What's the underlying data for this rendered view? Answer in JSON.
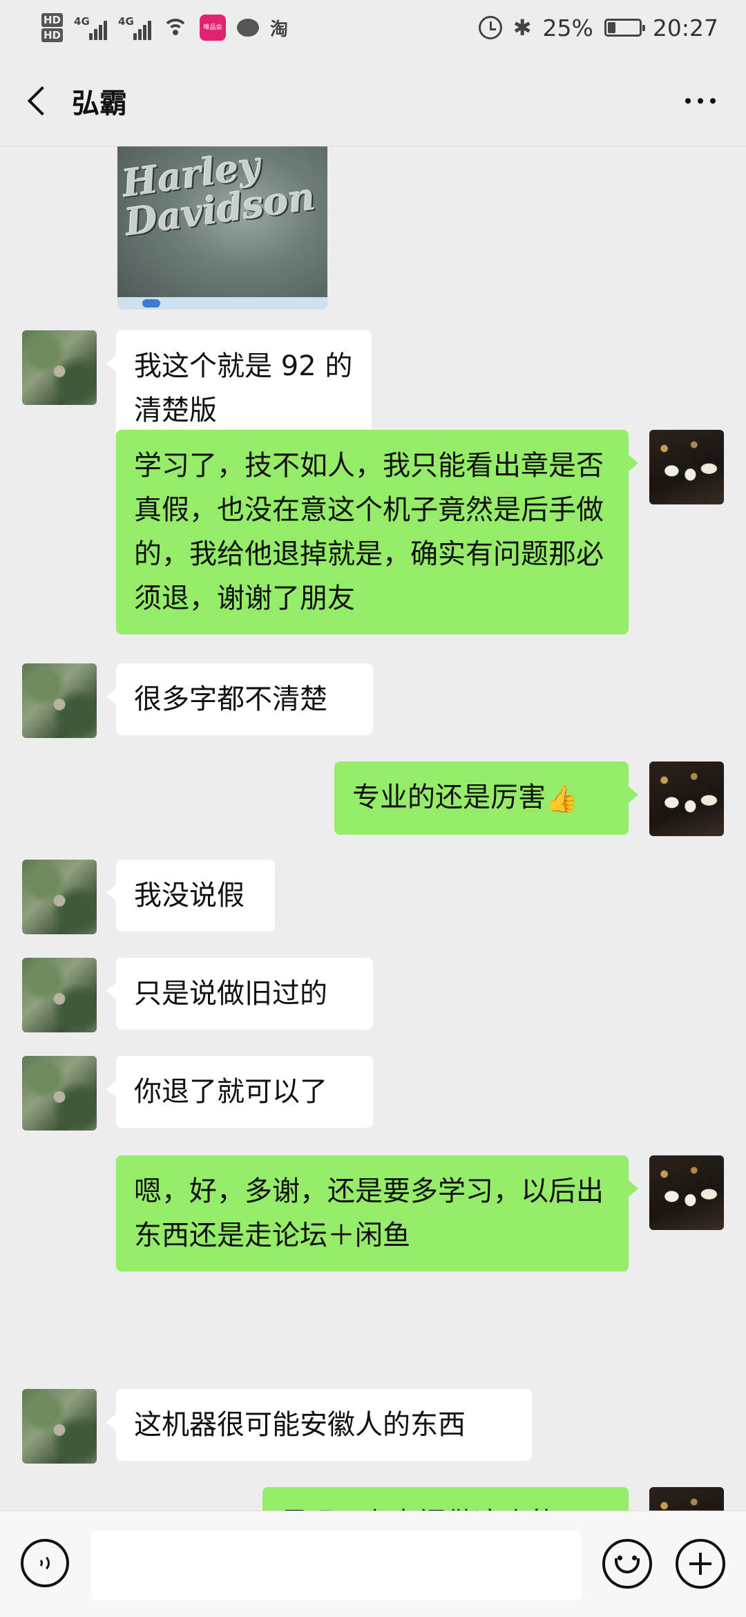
{
  "status_bar": {
    "hd1": "HD",
    "hd2": "HD",
    "net1": "4G",
    "net2": "4G",
    "app_badge": "唯品会",
    "taobao": "淘",
    "battery_text": "25%",
    "battery_level": 0.25,
    "time": "20:27",
    "icons": [
      "signal-icon",
      "wifi-icon",
      "vipshop-app-icon",
      "message-icon",
      "taobao-icon",
      "alarm-icon",
      "bluetooth-icon",
      "battery-icon"
    ]
  },
  "nav": {
    "title": "弘霸",
    "back_icon": "chevron-left-icon",
    "more_icon": "more-dots-icon"
  },
  "photo": {
    "engrave_line1": "Harley",
    "engrave_line2": "Davidson"
  },
  "messages": [
    {
      "from": "them",
      "text": "我这个就是 92 的  清楚版"
    },
    {
      "from": "me",
      "text": "学习了，技不如人，我只能看出章是否真假，也没在意这个机子竟然是后手做的，我给他退掉就是，确实有问题那必须退，谢谢了朋友"
    },
    {
      "from": "them",
      "text": "很多字都不清楚"
    },
    {
      "from": "me",
      "text": "专业的还是厉害",
      "emoji": "👍"
    },
    {
      "from": "them",
      "text": "我没说假"
    },
    {
      "from": "them",
      "text": "只是说做旧过的"
    },
    {
      "from": "them",
      "text": "你退了就可以了"
    },
    {
      "from": "me",
      "text": "嗯，好，多谢，还是要多学习，以后出东西还是走论坛＋闲鱼"
    },
    {
      "from": "them",
      "text": "这机器很可能安徽人的东西"
    },
    {
      "from": "me",
      "text": "是吗，有专门做这个的？"
    }
  ],
  "input_bar": {
    "voice_icon": "voice-icon",
    "emoji_icon": "emoji-icon",
    "plus_icon": "plus-icon",
    "placeholder": ""
  },
  "colors": {
    "background": "#ededed",
    "bubble_me": "#95ec69",
    "bubble_them": "#ffffff",
    "input_bar": "#f7f7f7"
  }
}
